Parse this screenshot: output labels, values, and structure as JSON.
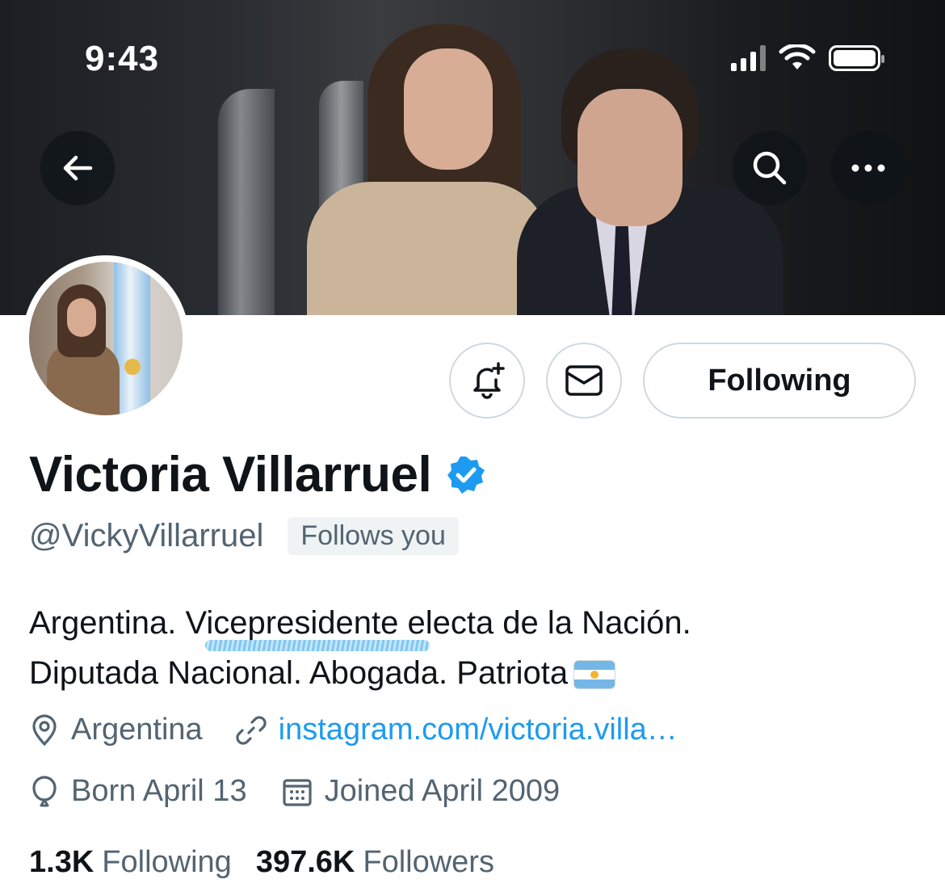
{
  "status_bar": {
    "time": "9:43"
  },
  "header": {
    "back_icon": "arrow-left-icon",
    "search_icon": "search-icon",
    "more_icon": "more-horizontal-icon"
  },
  "actions": {
    "notify_icon": "bell-plus-icon",
    "message_icon": "envelope-icon",
    "following_label": "Following"
  },
  "profile": {
    "display_name": "Victoria Villarruel",
    "verified_icon": "verified-badge-icon",
    "verified_color": "#1d9bf0",
    "handle": "@VickyVillarruel",
    "follows_you": "Follows you",
    "bio_line1": "Argentina. Vicepresidente electa de la Nación.",
    "bio_line2": "Diputada Nacional. Abogada. Patriota",
    "bio_flag_icon": "argentina-flag-emoji",
    "location": "Argentina",
    "website": "instagram.com/victoria.villa…",
    "birthday": "Born April 13",
    "joined": "Joined April 2009"
  },
  "stats": {
    "following_count": "1.3K",
    "following_label": "Following",
    "followers_count": "397.6K",
    "followers_label": "Followers"
  },
  "colors": {
    "text_primary": "#0f1419",
    "text_secondary": "#536471",
    "link": "#1d9bf0",
    "border": "#cfd9de"
  }
}
